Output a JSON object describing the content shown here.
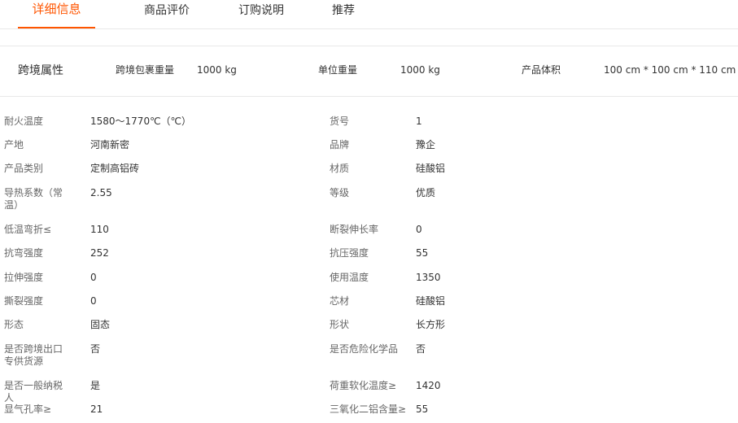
{
  "tabs": [
    {
      "label": "详细信息",
      "active": true
    },
    {
      "label": "商品评价",
      "active": false
    },
    {
      "label": "订购说明",
      "active": false
    },
    {
      "label": "推荐",
      "active": false
    }
  ],
  "cross_border": {
    "title": "跨境属性",
    "items": [
      {
        "label": "跨境包裹重量",
        "value": "1000 kg"
      },
      {
        "label": "单位重量",
        "value": "1000 kg"
      },
      {
        "label": "产品体积",
        "value": "100 cm * 100 cm * 110 cm"
      }
    ]
  },
  "attributes": {
    "left": [
      {
        "label": "耐火温度",
        "value": "1580～1770℃（℃）"
      },
      {
        "label": "产地",
        "value": "河南新密"
      },
      {
        "label": "产品类别",
        "value": "定制高铝砖"
      },
      {
        "label": "导热系数（常温）",
        "value": "2.55"
      },
      {
        "label": "低温弯折≤",
        "value": "110"
      },
      {
        "label": "抗弯强度",
        "value": "252"
      },
      {
        "label": "拉伸强度",
        "value": "0"
      },
      {
        "label": "撕裂强度",
        "value": "0"
      },
      {
        "label": "形态",
        "value": "固态"
      },
      {
        "label": "是否跨境出口专供货源",
        "value": "否"
      },
      {
        "label": "是否一般纳税人",
        "value": "是"
      },
      {
        "label": "显气孔率≥",
        "value": "21"
      }
    ],
    "right": [
      {
        "label": "货号",
        "value": "1"
      },
      {
        "label": "品牌",
        "value": "豫企"
      },
      {
        "label": "材质",
        "value": "硅酸铝"
      },
      {
        "label": "等级",
        "value": "优质"
      },
      {
        "label": "断裂伸长率",
        "value": "0"
      },
      {
        "label": "抗压强度",
        "value": "55"
      },
      {
        "label": "使用温度",
        "value": "1350"
      },
      {
        "label": "芯材",
        "value": "硅酸铝"
      },
      {
        "label": "形状",
        "value": "长方形"
      },
      {
        "label": "是否危险化学品",
        "value": "否"
      },
      {
        "label": "荷重软化温度≥",
        "value": "1420"
      },
      {
        "label": "三氧化二铝含量≥",
        "value": "55"
      }
    ]
  },
  "colors": {
    "accent": "#ff5500",
    "label": "#666666",
    "text": "#333333",
    "border": "#e8e8e8"
  }
}
